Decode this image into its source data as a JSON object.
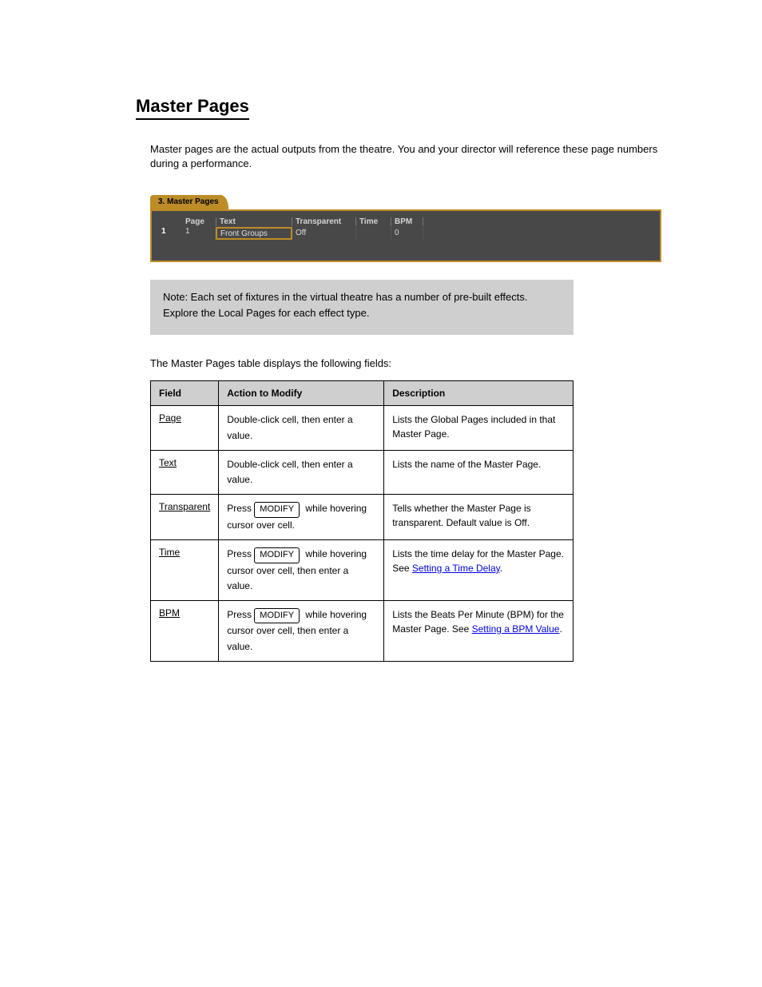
{
  "header": "Master Pages",
  "intro": "Master pages are the actual outputs from the theatre. You and your director will reference these page numbers during a performance.",
  "shot": {
    "tab": "3. Master Pages",
    "headers": {
      "page": "Page",
      "text": "Text",
      "transparent": "Transparent",
      "time": "Time",
      "bpm": "BPM"
    },
    "row": {
      "index": "1",
      "page": "1",
      "text": "Front Groups",
      "transparent": "Off",
      "time": "",
      "bpm": "0"
    }
  },
  "note": "Note: Each set of fixtures in the virtual theatre has a number of pre-built effects. Explore the Local Pages for each effect type.",
  "fieldsline": "The Master Pages table displays the following fields:",
  "table": {
    "head": {
      "field": "Field",
      "action": "Action to Modify",
      "desc": "Description"
    },
    "rows": [
      {
        "field": "Page",
        "action": "Double-click cell, then enter a value.",
        "desc": "Lists the Global Pages included in that Master Page."
      },
      {
        "field": "Text",
        "action": "Double-click cell, then enter a value.",
        "desc": "Lists the name of the Master Page."
      },
      {
        "field": "Transparent",
        "action_prefix": "Press ",
        "action_button": "MODIFY",
        "action_suffix": " while hovering cursor over cell.",
        "desc": "Tells whether the Master Page is transparent. Default value is Off."
      },
      {
        "field": "Time",
        "action_prefix": "Press ",
        "action_button": "MODIFY",
        "action_suffix": " while hovering cursor over cell, then enter a value.",
        "desc_pre": "Lists the time delay for the Master Page. See ",
        "desc_link": "Setting a Time Delay",
        "desc_post": "."
      },
      {
        "field": "BPM",
        "action_prefix": "Press ",
        "action_button": "MODIFY",
        "action_suffix": " while hovering cursor over cell, then enter a value.",
        "desc_pre": "Lists the Beats Per Minute (BPM) for the Master Page. See ",
        "desc_link": "Setting a BPM Value",
        "desc_post": "."
      }
    ]
  }
}
